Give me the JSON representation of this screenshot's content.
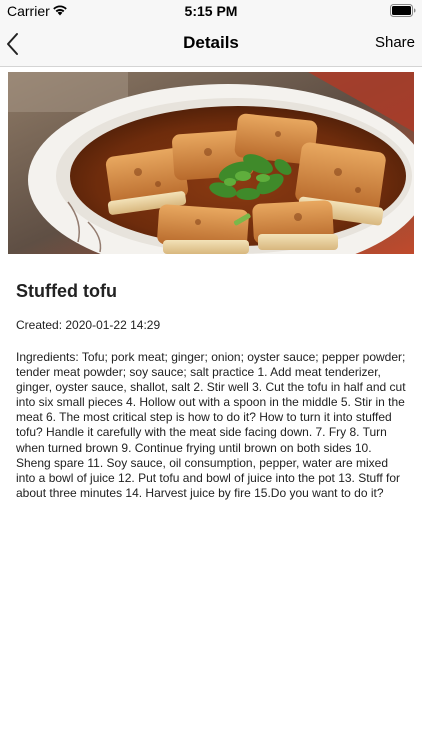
{
  "status_bar": {
    "carrier": "Carrier",
    "time": "5:15 PM"
  },
  "nav": {
    "title": "Details",
    "share_label": "Share"
  },
  "recipe": {
    "title": "Stuffed tofu",
    "created_label": "Created:",
    "created_value": "2020-01-22 14:29",
    "ingredients": "Ingredients: Tofu; pork meat; ginger; onion; oyster sauce; pepper powder; tender meat powder; soy sauce; salt  practice  1. Add meat tenderizer, ginger, oyster sauce, shallot, salt  2. Stir well  3. Cut the tofu in half and cut into six small pieces  4. Hollow out with a spoon in the middle  5. Stir in the meat  6. The most critical step is how to do it? How to turn it into stuffed tofu? Handle it carefully with the meat side facing down.  7. Fry  8. Turn when turned brown  9. Continue frying until brown on both sides  10. Sheng spare  11. Soy sauce, oil consumption, pepper, water are mixed into a bowl of juice  12. Put tofu and bowl of juice into the pot  13. Stuff for about three minutes  14. Harvest juice by fire  15.Do you want to do it?"
  },
  "icons": {
    "wifi": "wifi-icon",
    "battery": "battery-icon",
    "back": "chevron-left-icon"
  }
}
